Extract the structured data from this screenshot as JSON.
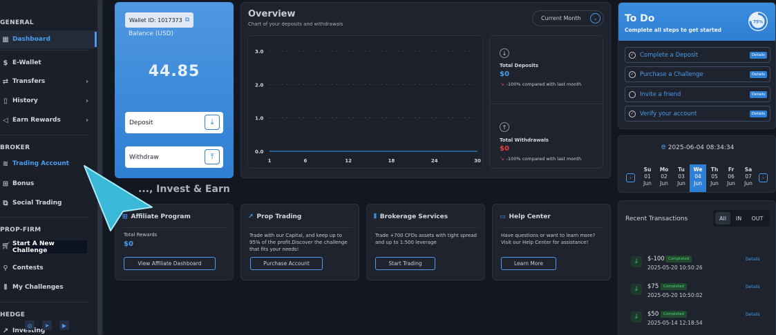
{
  "sidebar": {
    "sections": {
      "general": "GENERAL",
      "broker": "BROKER",
      "prop_firm": "PROP-FIRM",
      "hedge": "HEDGE"
    },
    "items": [
      {
        "label": "Dashboard"
      },
      {
        "label": "E-Wallet"
      },
      {
        "label": "Transfers"
      },
      {
        "label": "History"
      },
      {
        "label": "Earn Rewards"
      },
      {
        "label": "Trading Account"
      },
      {
        "label": "Bonus"
      },
      {
        "label": "Social Trading"
      },
      {
        "label": "Start A New Challenge"
      },
      {
        "label": "Contests"
      },
      {
        "label": "My Challenges"
      },
      {
        "label": "Investing"
      }
    ]
  },
  "wallet": {
    "id_label": "Wallet ID: 1017373",
    "balance_label": "Balance (USD)",
    "amount": "44.85",
    "deposit_label": "Deposit",
    "withdraw_label": "Withdraw"
  },
  "overview": {
    "title": "Overview",
    "subtitle": "Chart of your deposits and withdrawals",
    "period": "Current Month",
    "total_deposits_label": "Total Deposits",
    "total_deposits_value": "$0",
    "total_deposits_cmp": "-100% compared with last month",
    "total_withdrawals_label": "Total Withdrawals",
    "total_withdrawals_value": "$0",
    "total_withdrawals_cmp": "-100% compared with last month"
  },
  "chart_data": {
    "type": "line",
    "x": [
      1,
      6,
      12,
      18,
      24,
      30
    ],
    "series": [
      {
        "values": [
          0,
          0,
          0,
          0,
          0,
          0
        ]
      }
    ],
    "y_ticks": [
      "0.0",
      "1.0",
      "2.0",
      "3.0"
    ],
    "x_ticks": [
      "1",
      "6",
      "12",
      "18",
      "24",
      "30"
    ],
    "ylim": [
      0,
      3
    ],
    "xlim": [
      1,
      30
    ],
    "grid": true,
    "color": "#2f7fd4"
  },
  "section_heading": "..., Invest & Earn",
  "cards": [
    {
      "title": "Affiliate Program",
      "rewards_label": "Total Rewards",
      "rewards_value": "$0",
      "button": "View Affiliate Dashboard"
    },
    {
      "title": "Prop Trading",
      "desc": "Trade with our Capital, and keep up to 95% of the profit.Discover the challenge that fits your needs!",
      "button": "Purchase Account"
    },
    {
      "title": "Brokerage Services",
      "desc": "Trade +700 CFDs assets with tight spread and up to 1:500 leverage",
      "button": "Start Trading"
    },
    {
      "title": "Help Center",
      "desc": "Have questions or want to learn more? Visit our Help Center for assistance!",
      "button": "Learn More"
    }
  ],
  "todo": {
    "title": "To Do",
    "subtitle": "Complete all steps to get started",
    "progress": "75%",
    "progress_fraction": 0.75,
    "details_label": "Details",
    "items": [
      {
        "label": "Complete a Deposit",
        "done": true
      },
      {
        "label": "Purchase a Challenge",
        "done": true
      },
      {
        "label": "Invite a friend",
        "done": false
      },
      {
        "label": "Verify your account",
        "done": true
      }
    ]
  },
  "calendar": {
    "datetime": "2025-06-04 08:34:34",
    "days": [
      {
        "dow": "Su",
        "day": "01",
        "month": "Jun"
      },
      {
        "dow": "Mo",
        "day": "02",
        "month": "Jun"
      },
      {
        "dow": "Tu",
        "day": "03",
        "month": "Jun"
      },
      {
        "dow": "We",
        "day": "04",
        "month": "Jun",
        "selected": true
      },
      {
        "dow": "Th",
        "day": "05",
        "month": "Jun"
      },
      {
        "dow": "Fr",
        "day": "06",
        "month": "Jun"
      },
      {
        "dow": "Sa",
        "day": "07",
        "month": "Jun"
      }
    ]
  },
  "transactions": {
    "title": "Recent Transactions",
    "tabs": [
      "All",
      "IN",
      "OUT"
    ],
    "details_label": "Details",
    "rows": [
      {
        "amount": "$-100",
        "status": "Completed",
        "time": "2025-05-20 10:50:26"
      },
      {
        "amount": "$75",
        "status": "Completed",
        "time": "2025-05-20 10:50:02"
      },
      {
        "amount": "$50",
        "status": "Completed",
        "time": "2025-05-14 12:18:54"
      }
    ]
  },
  "colors": {
    "accent": "#2f7fd4",
    "accent_light": "#4a9df0",
    "background": "#13171f",
    "card": "#1e232d",
    "negative": "#e04040",
    "positive": "#56d07c"
  }
}
